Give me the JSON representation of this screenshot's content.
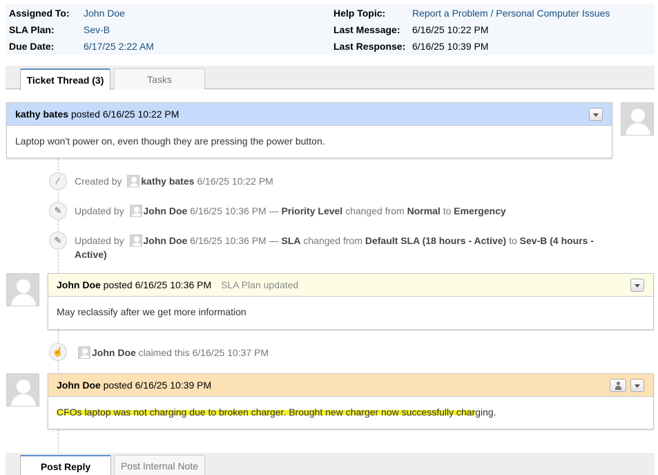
{
  "info": {
    "assigned_to_label": "Assigned To:",
    "assigned_to_value": "John Doe",
    "sla_plan_label": "SLA Plan:",
    "sla_plan_value": "Sev-B",
    "due_date_label": "Due Date:",
    "due_date_value": "6/17/25 2:22 AM",
    "help_topic_label": "Help Topic:",
    "help_topic_value": "Report a Problem / Personal Computer Issues",
    "last_message_label": "Last Message:",
    "last_message_value": "6/16/25 10:22 PM",
    "last_response_label": "Last Response:",
    "last_response_value": "6/16/25 10:39 PM"
  },
  "tabs": {
    "thread": "Ticket Thread (3)",
    "tasks": "Tasks"
  },
  "thread": {
    "entry1": {
      "author": "kathy bates",
      "posted": "posted 6/16/25 10:22 PM",
      "body": "Laptop won't power on, even though they are pressing the power button.",
      "header_color": "#c6dbfc"
    },
    "event1": {
      "prefix": "Created by",
      "user": "kathy bates",
      "time": "6/16/25 10:22 PM"
    },
    "event2": {
      "prefix": "Updated by",
      "user": "John Doe",
      "time": "6/16/25 10:36 PM —",
      "field": "Priority Level",
      "changed_from": "changed from",
      "from": "Normal",
      "to_word": "to",
      "to": "Emergency"
    },
    "event3": {
      "prefix": "Updated by",
      "user": "John Doe",
      "time": "6/16/25 10:36 PM —",
      "field": "SLA",
      "changed_from": "changed from",
      "from": "Default SLA (18 hours - Active)",
      "to_word": "to",
      "to": "Sev-B (4 hours -",
      "to_cont": "Active)"
    },
    "entry2": {
      "author": "John Doe",
      "posted": "posted 6/16/25 10:36 PM",
      "note": "SLA Plan updated",
      "body": "May reclassify after we get more information",
      "header_color": "#fdfde6"
    },
    "event4": {
      "user": "John Doe",
      "text": "claimed this 6/16/25 10:37 PM"
    },
    "entry3": {
      "author": "John Doe",
      "posted": "posted 6/16/25 10:39 PM",
      "body_highlighted": "CFOs laptop was not charging due to broken charger. Brought new charger now successfully char",
      "body_rest": "ging.",
      "header_color": "#fce1b5"
    }
  },
  "reply_tabs": {
    "post_reply": "Post Reply",
    "post_internal_note": "Post Internal Note"
  },
  "icons": {
    "created": "magic-wand-icon",
    "updated": "pencil-icon",
    "claimed": "thumbs-up-icon",
    "dropdown": "chevron-down-icon",
    "assign": "user-icon",
    "avatar": "avatar-placeholder-icon"
  }
}
